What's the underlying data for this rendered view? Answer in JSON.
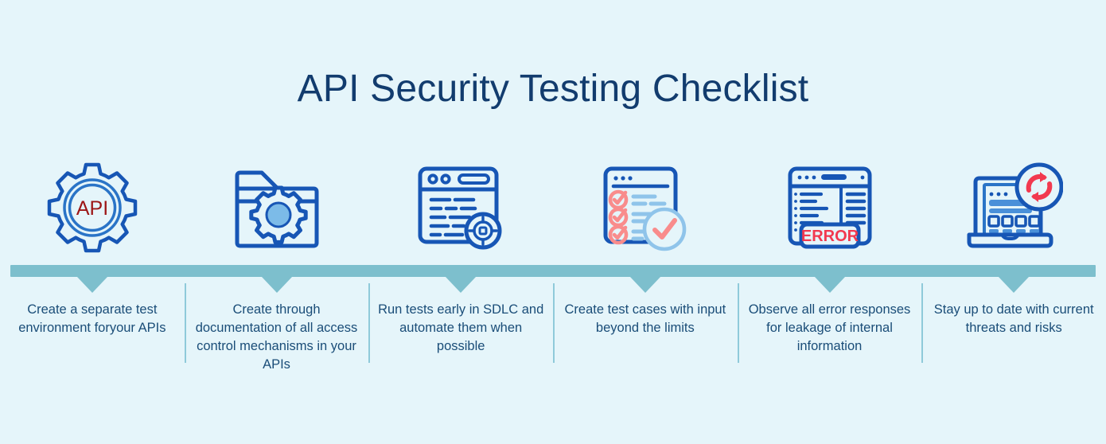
{
  "title": "API Security Testing Checklist",
  "colors": {
    "background": "#e5f5fa",
    "title_navy": "#123c6e",
    "timeline_teal": "#7dbfcd",
    "divider_teal": "#8fcada",
    "icon_blue": "#1756b5",
    "icon_light_blue": "#7cbbe8",
    "accent_red": "#f2394f",
    "caption_blue": "#1a4d78"
  },
  "timeline": {
    "bar_label": "timeline-bar"
  },
  "steps": [
    {
      "icon": "api-gear-icon",
      "icon_label": "API",
      "caption": "Create a separate test environment foryour APIs"
    },
    {
      "icon": "folder-gear-icon",
      "icon_label": "",
      "caption": "Create through documentation of all access control mechanisms in your APIs"
    },
    {
      "icon": "code-window-target-icon",
      "icon_label": "",
      "caption": "Run tests early in SDLC and automate them when possible"
    },
    {
      "icon": "checklist-check-icon",
      "icon_label": "",
      "caption": "Create test cases with input beyond the limits"
    },
    {
      "icon": "error-window-icon",
      "icon_label": "ERROR",
      "caption": "Observe all error responses for leakage of internal information"
    },
    {
      "icon": "laptop-refresh-icon",
      "icon_label": "",
      "caption": "Stay up to date with current threats and risks"
    }
  ]
}
